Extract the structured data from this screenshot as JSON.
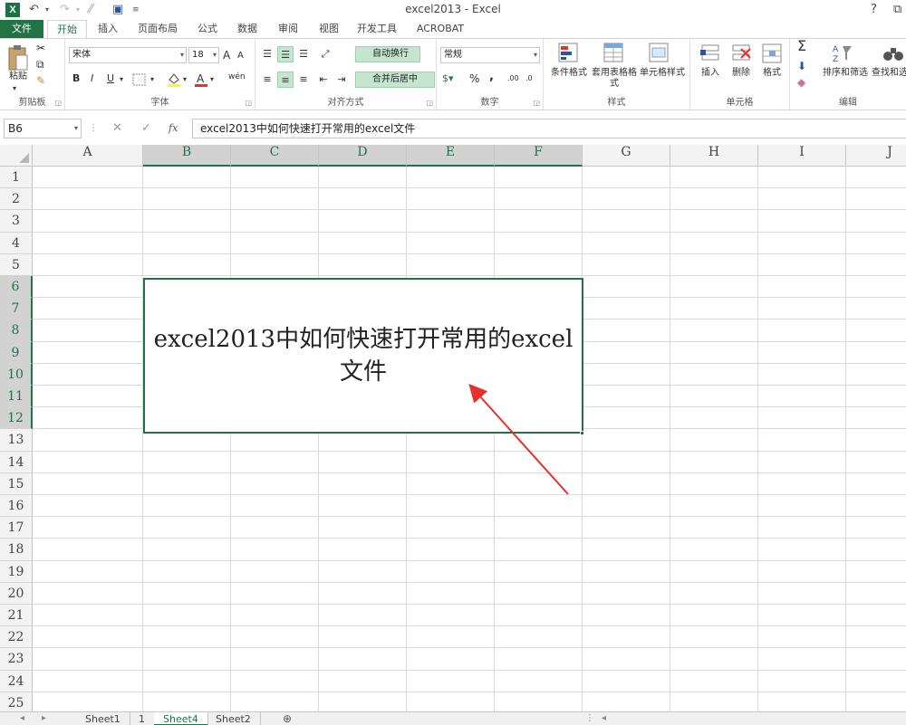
{
  "window": {
    "title": "excel2013 - Excel",
    "help_glyph": "?",
    "restore_glyph": "⧉",
    "minimize_glyph": "—"
  },
  "quick_access": {
    "app_glyph": "X",
    "undo": "↶",
    "redo": "↷",
    "save": "▣",
    "more": "≡"
  },
  "ribbon_tabs": [
    "文件",
    "开始",
    "插入",
    "页面布局",
    "公式",
    "数据",
    "审阅",
    "视图",
    "开发工具",
    "ACROBAT"
  ],
  "ribbon": {
    "clipboard": {
      "label": "剪贴板",
      "paste": "粘贴"
    },
    "font": {
      "label": "字体",
      "name": "宋体",
      "size": "18",
      "bold": "B",
      "italic": "I",
      "underline": "U",
      "grow": "A",
      "shrink": "A"
    },
    "alignment": {
      "label": "对齐方式",
      "wrap": "自动换行",
      "merge": "合并后居中"
    },
    "number": {
      "label": "数字",
      "format": "常规",
      "percent": "%",
      "comma": ","
    },
    "styles": {
      "label": "样式",
      "conditional": "条件格式",
      "table": "套用表格格式",
      "cell_styles": "单元格样式"
    },
    "cells": {
      "label": "单元格",
      "insert": "插入",
      "delete": "删除",
      "format": "格式"
    },
    "editing": {
      "label": "编辑",
      "sort": "排序和筛选",
      "find": "查找和选",
      "sum": "Σ"
    }
  },
  "formula_bar": {
    "name_box": "B6",
    "cancel": "✕",
    "enter": "✓",
    "fx": "fx",
    "value": "excel2013中如何快速打开常用的excel文件"
  },
  "grid": {
    "columns": [
      "A",
      "B",
      "C",
      "D",
      "E",
      "F",
      "G",
      "H",
      "I",
      "J"
    ],
    "rows": [
      "1",
      "2",
      "3",
      "4",
      "5",
      "6",
      "7",
      "8",
      "9",
      "10",
      "11",
      "12",
      "13",
      "14",
      "15",
      "16",
      "17",
      "18",
      "19",
      "20",
      "21",
      "22",
      "23",
      "24",
      "25"
    ],
    "selected_columns": [
      "B",
      "C",
      "D",
      "E",
      "F"
    ],
    "selected_rows": [
      "6",
      "7",
      "8",
      "9",
      "10",
      "11",
      "12"
    ],
    "merged_cell": {
      "range": "B6:F12",
      "text": "excel2013中如何快速打开常用的excel文件"
    }
  },
  "sheet_tabs": {
    "tabs": [
      "Sheet1",
      "1",
      "Sheet4",
      "Sheet2"
    ],
    "active": "Sheet4",
    "add": "⊕"
  },
  "colors": {
    "accent": "#217346",
    "arrow": "#e8302a",
    "grid_line": "#dadada",
    "header_bg": "#f3f3f3"
  }
}
